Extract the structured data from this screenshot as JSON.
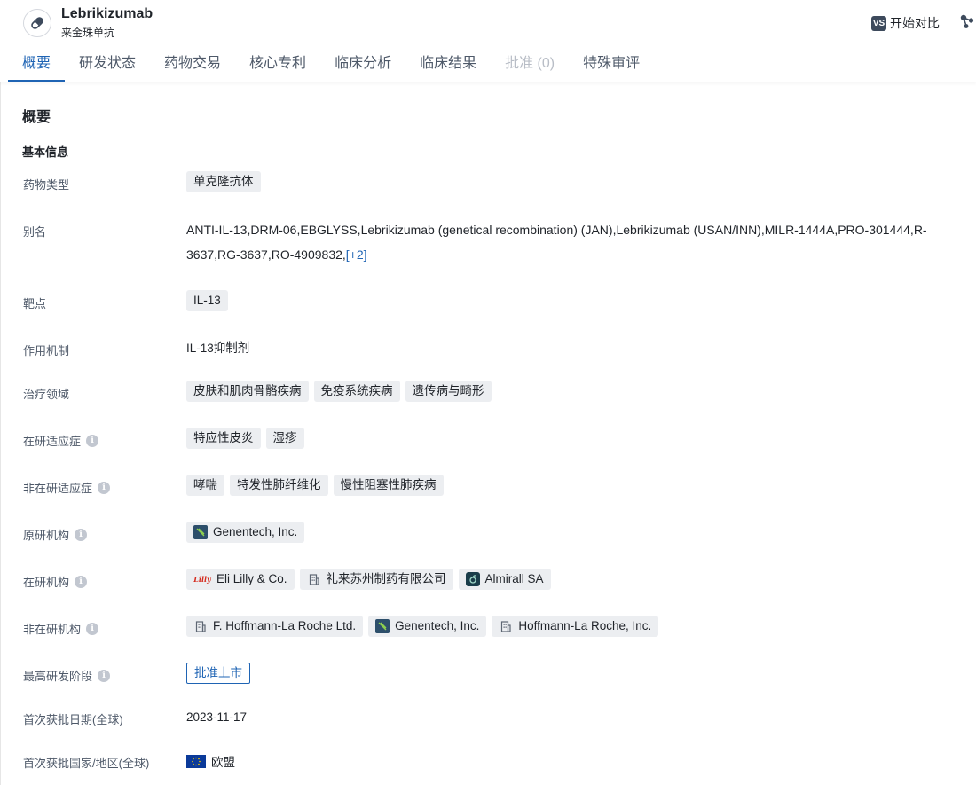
{
  "header": {
    "title": "Lebrikizumab",
    "subtitle": "来金珠单抗",
    "compare_badge": "VS",
    "compare_label": "开始对比"
  },
  "tabs": [
    {
      "label": "概要",
      "state": "active"
    },
    {
      "label": "研发状态",
      "state": "normal"
    },
    {
      "label": "药物交易",
      "state": "normal"
    },
    {
      "label": "核心专利",
      "state": "normal"
    },
    {
      "label": "临床分析",
      "state": "normal"
    },
    {
      "label": "临床结果",
      "state": "normal"
    },
    {
      "label": "批准 (0)",
      "state": "disabled"
    },
    {
      "label": "特殊审评",
      "state": "normal"
    }
  ],
  "section_title": "概要",
  "subsection_title": "基本信息",
  "fields": {
    "drug_type": {
      "label": "药物类型",
      "tags": [
        "单克隆抗体"
      ]
    },
    "aliases": {
      "label": "别名",
      "text": "ANTI-IL-13,DRM-06,EBGLYSS,Lebrikizumab (genetical recombination) (JAN),Lebrikizumab (USAN/INN),MILR-1444A,PRO-301444,R-3637,RG-3637,RO-4909832,",
      "more": "[+2]"
    },
    "target": {
      "label": "靶点",
      "tags": [
        "IL-13"
      ]
    },
    "mechanism": {
      "label": "作用机制",
      "text": "IL-13抑制剂"
    },
    "therapeutic_area": {
      "label": "治疗领域",
      "tags": [
        "皮肤和肌肉骨骼疾病",
        "免疫系统疾病",
        "遗传病与畸形"
      ]
    },
    "active_indications": {
      "label": "在研适应症",
      "info": "i",
      "tags": [
        "特应性皮炎",
        "湿疹"
      ]
    },
    "inactive_indications": {
      "label": "非在研适应症",
      "info": "i",
      "tags": [
        "哮喘",
        "特发性肺纤维化",
        "慢性阻塞性肺疾病"
      ]
    },
    "originator": {
      "label": "原研机构",
      "info": "i",
      "orgs": [
        {
          "name": "Genentech, Inc.",
          "logo": "genentech-logo"
        }
      ]
    },
    "active_orgs": {
      "label": "在研机构",
      "info": "i",
      "orgs": [
        {
          "name": "Eli Lilly & Co.",
          "logo": "lilly-logo",
          "logo_text": "Lilly"
        },
        {
          "name": "礼来苏州制药有限公司",
          "logo": "building-icon"
        },
        {
          "name": "Almirall SA",
          "logo": "almirall-logo"
        }
      ]
    },
    "inactive_orgs": {
      "label": "非在研机构",
      "info": "i",
      "orgs": [
        {
          "name": "F. Hoffmann-La Roche Ltd.",
          "logo": "building-icon"
        },
        {
          "name": "Genentech, Inc.",
          "logo": "genentech-logo"
        },
        {
          "name": "Hoffmann-La Roche, Inc.",
          "logo": "building-icon"
        }
      ]
    },
    "highest_phase": {
      "label": "最高研发阶段",
      "info": "i",
      "status": "批准上市"
    },
    "first_approval_date": {
      "label": "首次获批日期(全球)",
      "text": "2023-11-17"
    },
    "first_approval_region": {
      "label": "首次获批国家/地区(全球)",
      "flag": "eu-flag-icon",
      "text": "欧盟"
    }
  },
  "colors": {
    "accent": "#1f64b4",
    "tag_bg": "#eceef1",
    "label": "#4e5969"
  }
}
